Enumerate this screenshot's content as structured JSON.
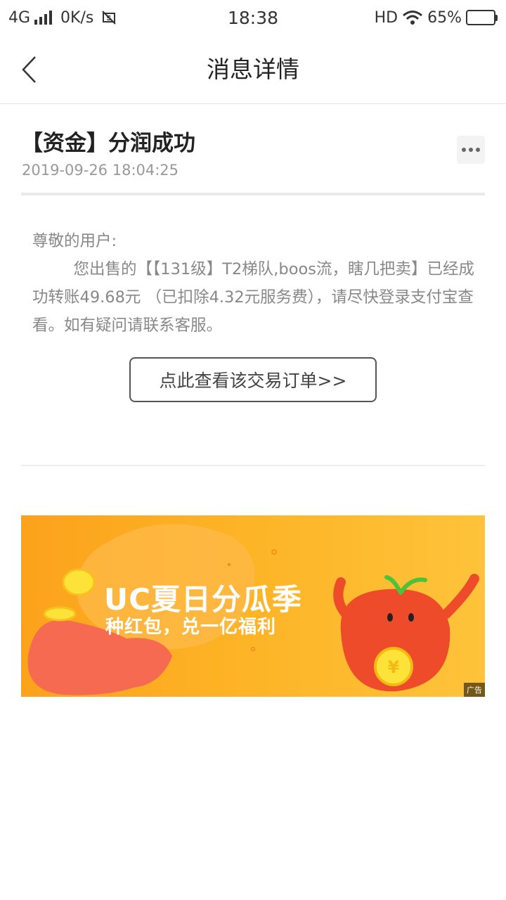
{
  "status_bar": {
    "network": "4G",
    "speed": "0K/s",
    "time": "18:38",
    "hd": "HD",
    "battery_percent": "65%",
    "battery_level": 0.65
  },
  "nav": {
    "title": "消息详情",
    "back_icon": "chevron-left-icon"
  },
  "message": {
    "title": "【资金】分润成功",
    "timestamp": "2019-09-26 18:04:25",
    "more_icon": "more-icon",
    "greeting": "尊敬的用户:",
    "content": "您出售的【【131级】T2梯队,boos流，瞎几把卖】已经成功转账49.68元 （已扣除4.32元服务费），请尽快登录支付宝查看。如有疑问请联系客服。",
    "order_button_label": "点此查看该交易订单>>"
  },
  "ad": {
    "title": "UC夏日分瓜季",
    "subtitle": "种红包，兑一亿福利",
    "badge": "广告",
    "colors": {
      "bg_start": "#fca21c",
      "bg_end": "#fec33a",
      "blob": "#f56a50",
      "mascot": "#ee4b2b"
    }
  }
}
